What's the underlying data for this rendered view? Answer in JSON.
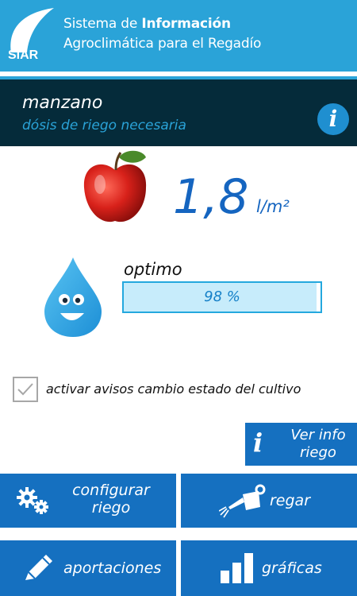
{
  "header": {
    "logo_text": "SiAR",
    "title_line1_prefix": "Sistema de ",
    "title_line1_bold": "Información",
    "title_line2": "Agroclimática para el Regadío"
  },
  "crop": {
    "name": "manzano",
    "subtitle": "dósis de riego necesaria",
    "info_icon": "info-icon"
  },
  "dose": {
    "value": "1,8",
    "unit": "l/m²"
  },
  "status": {
    "label": "optimo",
    "percent_text": "98 %",
    "percent_value": 0.98
  },
  "alerts": {
    "checked": true,
    "label": "activar avisos cambio estado del cultivo"
  },
  "ver_info": {
    "label_line1": "Ver info",
    "label_line2": "riego"
  },
  "tiles": {
    "configure": {
      "line1": "configurar",
      "line2": "riego",
      "icon": "gears-icon"
    },
    "water": {
      "label": "regar",
      "icon": "watering-can-icon"
    },
    "contributions": {
      "label": "aportaciones",
      "icon": "pencil-icon"
    },
    "charts": {
      "label": "gráficas",
      "icon": "bar-chart-icon"
    }
  },
  "colors": {
    "header_blue": "#2aa3d8",
    "dark_bar": "#052b3a",
    "tile_blue": "#1570c0",
    "value_blue": "#1565c0"
  }
}
